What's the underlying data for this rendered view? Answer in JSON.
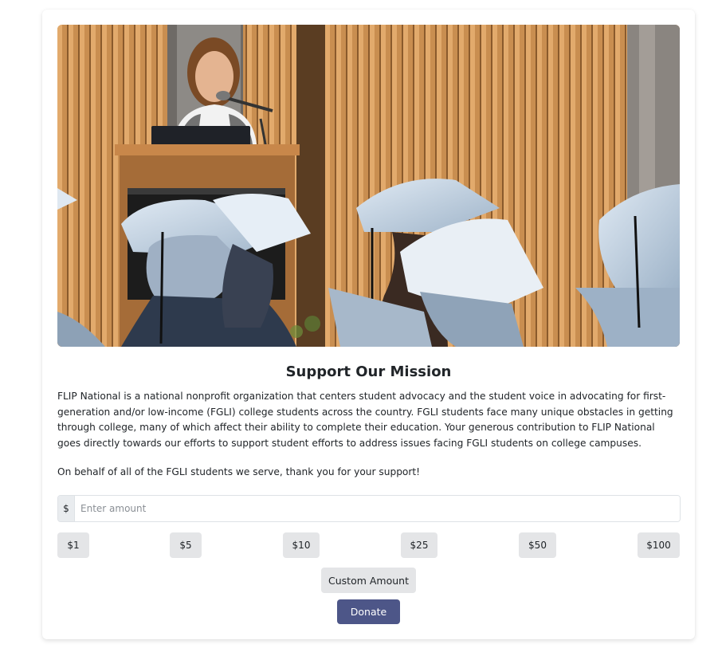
{
  "hero": {
    "image_name": "graduation-speaker-photo",
    "colors": {
      "wood": "#c0894d",
      "cap": "#b9cce0",
      "dark": "#2b2622"
    }
  },
  "title": "Support Our Mission",
  "description": "FLIP National is a national nonprofit organization that centers student advocacy and the student voice in advocating for first-generation and/or low-income (FGLI) college students across the country. FGLI students face many unique obstacles in getting through college, many of which affect their ability to complete their education. Your generous contribution to FLIP National goes directly towards our efforts to support student efforts to address issues facing FGLI students on college campuses.",
  "thanks": "On behalf of all of the FGLI students we serve, thank you for your support!",
  "amount": {
    "prefix": "$",
    "value": "",
    "placeholder": "Enter amount"
  },
  "presets": [
    "$1",
    "$5",
    "$10",
    "$25",
    "$50",
    "$100"
  ],
  "custom_label": "Custom Amount",
  "donate_label": "Donate",
  "colors": {
    "donate_bg": "#4d5688",
    "preset_bg": "#e4e5e7"
  }
}
